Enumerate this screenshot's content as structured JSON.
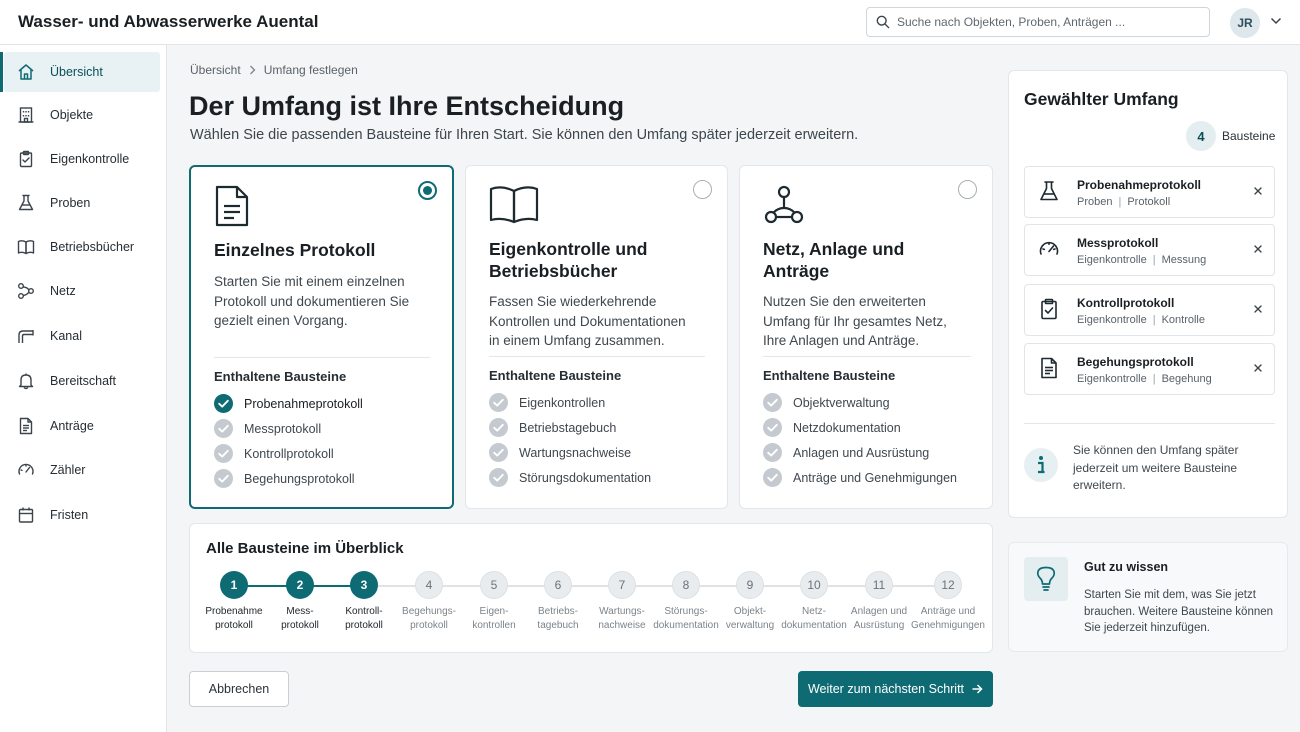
{
  "app": {
    "title": "Wasser- und Abwasserwerke Auental"
  },
  "search": {
    "placeholder": "Suche nach Objekten, Proben, Anträgen ..."
  },
  "user": {
    "initials": "JR"
  },
  "sidebar": {
    "items": [
      {
        "label": "Übersicht",
        "icon": "home-icon",
        "active": true
      },
      {
        "label": "Objekte",
        "icon": "building-icon"
      },
      {
        "label": "Eigenkontrolle",
        "icon": "clipboard-check-icon"
      },
      {
        "label": "Proben",
        "icon": "flask-icon"
      },
      {
        "label": "Betriebsbücher",
        "icon": "book-icon"
      },
      {
        "label": "Netz",
        "icon": "network-icon"
      },
      {
        "label": "Kanal",
        "icon": "pipe-icon"
      },
      {
        "label": "Bereitschaft",
        "icon": "bell-icon"
      },
      {
        "label": "Anträge",
        "icon": "document-icon"
      },
      {
        "label": "Zähler",
        "icon": "gauge-icon"
      },
      {
        "label": "Fristen",
        "icon": "calendar-icon"
      }
    ]
  },
  "breadcrumb": {
    "root": "Übersicht",
    "current": "Umfang festlegen"
  },
  "page": {
    "title": "Der Umfang ist Ihre Entscheidung",
    "subtitle": "Wählen Sie die passenden Bausteine für Ihren Start. Sie können den Umfang später jederzeit erweitern."
  },
  "cards": [
    {
      "title": "Einzelnes Protokoll",
      "icon": "document-icon",
      "selected": true,
      "description": "Starten Sie mit einem einzelnen Protokoll und dokumentieren Sie gezielt einen Vorgang.",
      "section_label": "Enthaltene Bausteine",
      "items": [
        {
          "label": "Probenahmeprotokoll",
          "checked": true
        },
        {
          "label": "Messprotokoll",
          "checked": false
        },
        {
          "label": "Kontrollprotokoll",
          "checked": false
        },
        {
          "label": "Begehungsprotokoll",
          "checked": false
        }
      ]
    },
    {
      "title": "Eigenkontrolle und Betriebsbücher",
      "icon": "book-open-icon",
      "selected": false,
      "description": "Fassen Sie wiederkehrende Kontrollen und Dokumentationen in einem Umfang zusammen.",
      "section_label": "Enthaltene Bausteine",
      "items": [
        {
          "label": "Eigenkontrollen",
          "checked": false
        },
        {
          "label": "Betriebstagebuch",
          "checked": false
        },
        {
          "label": "Wartungsnachweise",
          "checked": false
        },
        {
          "label": "Störungsdokumentation",
          "checked": false
        }
      ]
    },
    {
      "title": "Netz, Anlage und Anträge",
      "icon": "network-icon",
      "selected": false,
      "description": "Nutzen Sie den erweiterten Umfang für Ihr gesamtes Netz, Ihre Anlagen und Anträge.",
      "section_label": "Enthaltene Bausteine",
      "items": [
        {
          "label": "Objektverwaltung",
          "checked": false
        },
        {
          "label": "Netzdokumentation",
          "checked": false
        },
        {
          "label": "Anlagen und Ausrüstung",
          "checked": false
        },
        {
          "label": "Anträge und Genehmigungen",
          "checked": false
        }
      ]
    }
  ],
  "overview": {
    "title": "Alle Bausteine im Überblick",
    "steps": [
      {
        "number": "1",
        "line1": "Probenahme",
        "line2": "protokoll",
        "done": true
      },
      {
        "number": "2",
        "line1": "Mess-",
        "line2": "protokoll",
        "done": true
      },
      {
        "number": "3",
        "line1": "Kontroll-",
        "line2": "protokoll",
        "done": true
      },
      {
        "number": "4",
        "line1": "Begehungs-",
        "line2": "protokoll",
        "done": false
      },
      {
        "number": "5",
        "line1": "Eigen-",
        "line2": "kontrollen",
        "done": false
      },
      {
        "number": "6",
        "line1": "Betriebs-",
        "line2": "tagebuch",
        "done": false
      },
      {
        "number": "7",
        "line1": "Wartungs-",
        "line2": "nachweise",
        "done": false
      },
      {
        "number": "8",
        "line1": "Störungs-",
        "line2": "dokumentation",
        "done": false
      },
      {
        "number": "9",
        "line1": "Objekt-",
        "line2": "verwaltung",
        "done": false
      },
      {
        "number": "10",
        "line1": "Netz-",
        "line2": "dokumentation",
        "done": false
      },
      {
        "number": "11",
        "line1": "Anlagen und",
        "line2": "Ausrüstung",
        "done": false
      },
      {
        "number": "12",
        "line1": "Anträge und",
        "line2": "Genehmigungen",
        "done": false
      }
    ]
  },
  "actions": {
    "cancel_label": "Abbrechen",
    "next_label": "Weiter zum nächsten Schritt"
  },
  "scope": {
    "title": "Gewählter Umfang",
    "count": "4",
    "count_label": "Bausteine",
    "items": [
      {
        "title": "Probenahmeprotokoll",
        "category": "Proben",
        "type": "Protokoll",
        "icon": "flask-icon"
      },
      {
        "title": "Messprotokoll",
        "category": "Eigenkontrolle",
        "type": "Messung",
        "icon": "gauge-icon"
      },
      {
        "title": "Kontrollprotokoll",
        "category": "Eigenkontrolle",
        "type": "Kontrolle",
        "icon": "clipboard-check-icon"
      },
      {
        "title": "Begehungsprotokoll",
        "category": "Eigenkontrolle",
        "type": "Begehung",
        "icon": "document-icon"
      }
    ],
    "info_text": "Sie können den Umfang später jederzeit um weitere Bausteine erweitern."
  },
  "tip": {
    "title": "Gut zu wissen",
    "text": "Starten Sie mit dem, was Sie jetzt brauchen. Weitere Bausteine können Sie jederzeit hinzufügen."
  },
  "colors": {
    "accent": "#0e6b74",
    "accent_light": "#e8f1f4",
    "muted": "#c4cacf"
  }
}
